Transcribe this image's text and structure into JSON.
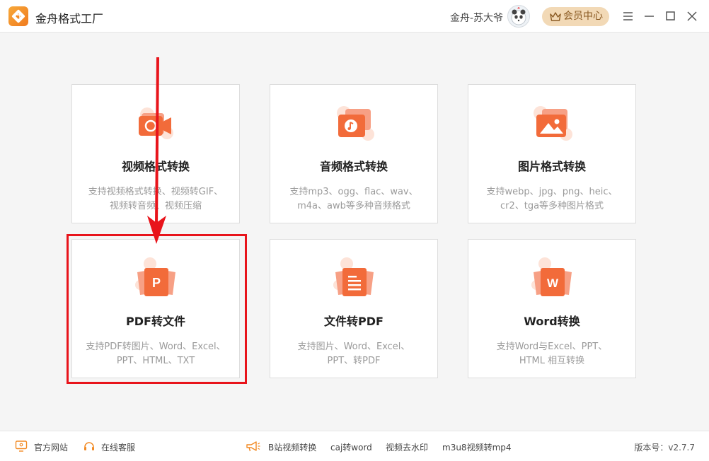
{
  "window": {
    "title": "金舟格式工厂",
    "username": "金舟-苏大爷",
    "vip_label": "会员中心"
  },
  "cards": [
    {
      "title": "视频格式转换",
      "desc_line1": "支持视频格式转换、视频转GIF、",
      "desc_line2": "视频转音频、视频压缩",
      "icon": "video-camera-icon"
    },
    {
      "title": "音频格式转换",
      "desc_line1": "支持mp3、ogg、flac、wav、",
      "desc_line2": "m4a、awb等多种音频格式",
      "icon": "music-note-icon"
    },
    {
      "title": "图片格式转换",
      "desc_line1": "支持webp、jpg、png、heic、",
      "desc_line2": "cr2、tga等多种图片格式",
      "icon": "image-icon"
    },
    {
      "title": "PDF转文件",
      "desc_line1": "支持PDF转图片、Word、Excel、",
      "desc_line2": "PPT、HTML、TXT",
      "icon": "pdf-p-icon"
    },
    {
      "title": "文件转PDF",
      "desc_line1": "支持图片、Word、Excel、",
      "desc_line2": "PPT、转PDF",
      "icon": "document-lines-icon"
    },
    {
      "title": "Word转换",
      "desc_line1": "支持Word与Excel、PPT、",
      "desc_line2": "HTML 相互转换",
      "icon": "word-w-icon"
    }
  ],
  "footer": {
    "website": "官方网站",
    "service": "在线客服",
    "links": [
      "B站视频转换",
      "caj转word",
      "视频去水印",
      "m3u8视频转mp4"
    ],
    "version": "版本号：v2.7.7"
  },
  "colors": {
    "accent": "#f26b3a",
    "highlight": "#e8141b",
    "vip_bg": "#f2d9b6"
  }
}
